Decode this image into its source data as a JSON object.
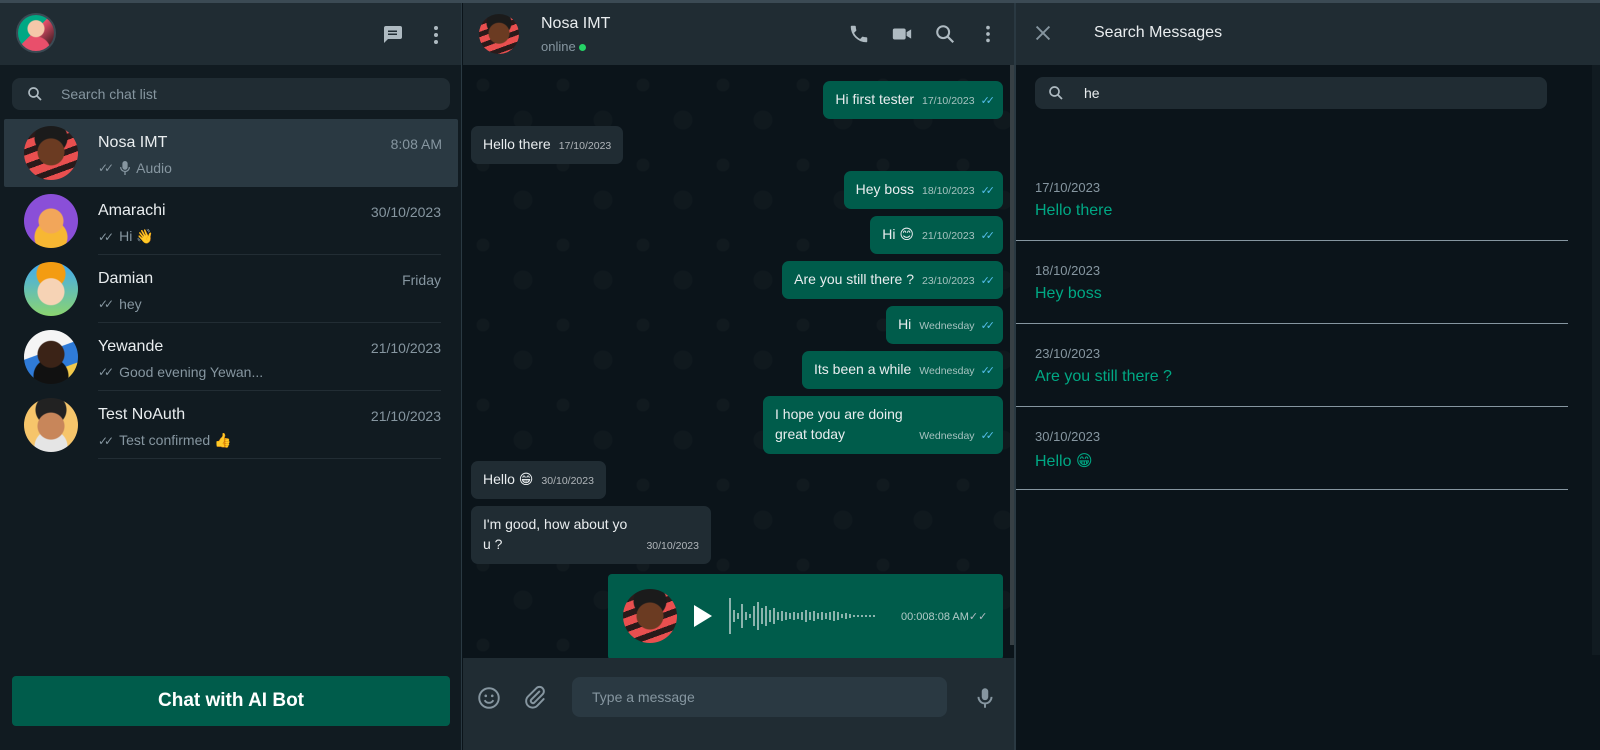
{
  "sidebar": {
    "search_placeholder": "Search chat list",
    "chats": [
      {
        "name": "Nosa IMT",
        "time": "8:08 AM",
        "preview_icon": "mic-icon",
        "preview": "Audio",
        "active": true
      },
      {
        "name": "Amarachi",
        "time": "30/10/2023",
        "preview": "Hi 👋"
      },
      {
        "name": "Damian",
        "time": "Friday",
        "preview": "hey"
      },
      {
        "name": "Yewande",
        "time": "21/10/2023",
        "preview": "Good evening Yewan..."
      },
      {
        "name": "Test NoAuth",
        "time": "21/10/2023",
        "preview": "Test confirmed 👍"
      }
    ],
    "ai_button": "Chat with AI Bot"
  },
  "conversation": {
    "contact_name": "Nosa IMT",
    "status": "online",
    "messages": [
      {
        "dir": "out",
        "text": "Hi first tester",
        "time": "17/10/2023"
      },
      {
        "dir": "in",
        "text": "Hello there",
        "time": "17/10/2023"
      },
      {
        "dir": "out",
        "text": "Hey boss",
        "time": "18/10/2023"
      },
      {
        "dir": "out",
        "text": "Hi 😊",
        "time": "21/10/2023"
      },
      {
        "dir": "out",
        "text": "Are you still there ?",
        "time": "23/10/2023"
      },
      {
        "dir": "out",
        "text": "Hi",
        "time": "Wednesday"
      },
      {
        "dir": "out",
        "text": "Its been a while",
        "time": "Wednesday"
      },
      {
        "dir": "out",
        "text_line1": "I hope you are doing",
        "text_line2": "great today",
        "time": "Wednesday"
      },
      {
        "dir": "in",
        "text": "Hello 😁",
        "time": "30/10/2023"
      },
      {
        "dir": "in",
        "text_line1": "I'm good, how about yo",
        "text_line2": "u ?",
        "time": "30/10/2023"
      }
    ],
    "voice_note": {
      "duration": "00:00",
      "time": "8:08 AM"
    },
    "composer_placeholder": "Type a message"
  },
  "search_panel": {
    "title": "Search Messages",
    "query": "he",
    "results": [
      {
        "date": "17/10/2023",
        "text": "Hello there"
      },
      {
        "date": "18/10/2023",
        "text": "Hey boss"
      },
      {
        "date": "23/10/2023",
        "text": "Are you still there ?"
      },
      {
        "date": "30/10/2023",
        "text": "Hello 😁"
      }
    ]
  },
  "colors": {
    "accent": "#00a884",
    "outgoing_bubble": "#005c4b",
    "incoming_bubble": "#202c33",
    "panel": "#111b21",
    "read_tick": "#53bdeb"
  }
}
